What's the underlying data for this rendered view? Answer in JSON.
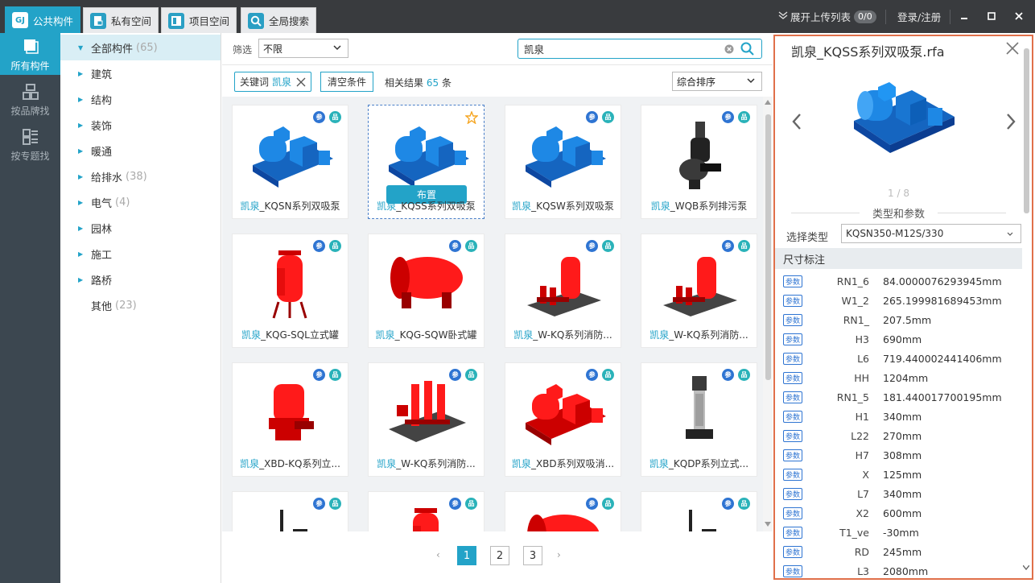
{
  "tabs": [
    {
      "label": "公共构件",
      "icon": "GJ",
      "active": true
    },
    {
      "label": "私有空间",
      "icon": "lock"
    },
    {
      "label": "项目空间",
      "icon": "project"
    },
    {
      "label": "全局搜索",
      "icon": "search"
    }
  ],
  "titlebar": {
    "upload_list": "展开上传列表",
    "upload_count": "0/0",
    "login": "登录/注册",
    "minimize": "_",
    "maximize": "□",
    "close": "✕"
  },
  "leftnav": [
    {
      "label": "所有构件",
      "active": true
    },
    {
      "label": "按品牌找"
    },
    {
      "label": "按专题找"
    }
  ],
  "tree": [
    {
      "label": "全部构件",
      "count": "(65)",
      "selected": true,
      "arrow": "▼"
    },
    {
      "label": "建筑",
      "count": "",
      "arrow": "▶"
    },
    {
      "label": "结构",
      "count": "",
      "arrow": "▶"
    },
    {
      "label": "装饰",
      "count": "",
      "arrow": "▶"
    },
    {
      "label": "暖通",
      "count": "",
      "arrow": "▶"
    },
    {
      "label": "给排水",
      "count": "(38)",
      "arrow": "▶"
    },
    {
      "label": "电气",
      "count": "(4)",
      "arrow": "▶"
    },
    {
      "label": "园林",
      "count": "",
      "arrow": "▶"
    },
    {
      "label": "施工",
      "count": "",
      "arrow": "▶"
    },
    {
      "label": "路桥",
      "count": "",
      "arrow": "▶"
    },
    {
      "label": "其他",
      "count": "(23)",
      "arrow": ""
    }
  ],
  "filter": {
    "label": "筛选",
    "value": "不限",
    "search_value": "凯泉"
  },
  "tags": {
    "keyword_label": "关键词",
    "keyword": "凯泉",
    "clear": "清空条件",
    "result_prefix": "相关结果",
    "result_count": "65",
    "result_suffix": "条",
    "sort": "综合排序"
  },
  "cards": [
    {
      "kw": "凯泉",
      "rest": "_KQSN系列双吸泵",
      "color": "blue",
      "shape": "pump"
    },
    {
      "kw": "凯泉",
      "rest": "_KQSS系列双吸泵",
      "color": "blue",
      "shape": "pump",
      "hover": true,
      "place": "布置"
    },
    {
      "kw": "凯泉",
      "rest": "_KQSW系列双吸泵",
      "color": "blue",
      "shape": "pump"
    },
    {
      "kw": "凯泉",
      "rest": "_WQB系列排污泵",
      "color": "black",
      "shape": "sewage"
    },
    {
      "kw": "凯泉",
      "rest": "_KQG-SQL立式罐",
      "color": "red",
      "shape": "vtank"
    },
    {
      "kw": "凯泉",
      "rest": "_KQG-SQW卧式罐",
      "color": "red",
      "shape": "htank"
    },
    {
      "kw": "凯泉",
      "rest": "_W-KQ系列消防...",
      "color": "red",
      "shape": "station"
    },
    {
      "kw": "凯泉",
      "rest": "_W-KQ系列消防...",
      "color": "red",
      "shape": "station"
    },
    {
      "kw": "凯泉",
      "rest": "_XBD-KQ系列立...",
      "color": "red",
      "shape": "vpump"
    },
    {
      "kw": "凯泉",
      "rest": "_W-KQ系列消防...",
      "color": "red",
      "shape": "multi"
    },
    {
      "kw": "凯泉",
      "rest": "_XBD系列双吸消...",
      "color": "red",
      "shape": "pump"
    },
    {
      "kw": "凯泉",
      "rest": "_KQDP系列立式...",
      "color": "black",
      "shape": "column"
    },
    {
      "kw": "",
      "rest": "",
      "color": "black",
      "shape": "misc"
    },
    {
      "kw": "",
      "rest": "",
      "color": "red",
      "shape": "vtank"
    },
    {
      "kw": "",
      "rest": "",
      "color": "red",
      "shape": "htank"
    },
    {
      "kw": "",
      "rest": "",
      "color": "black",
      "shape": "misc"
    }
  ],
  "pager": {
    "pages": [
      "1",
      "2",
      "3"
    ],
    "current": "1",
    "prev": "‹",
    "next": "›"
  },
  "detail": {
    "title": "凯泉_KQSS系列双吸泵.rfa",
    "counter": "1 / 8",
    "section": "类型和参数",
    "type_label": "选择类型",
    "type_value": "KQSN350-M12S/330",
    "dim_header": "尺寸标注",
    "tag": "参数",
    "params": [
      {
        "name": "RN1_6",
        "value": "84.0000076293945mm"
      },
      {
        "name": "W1_2",
        "value": "265.199981689453mm"
      },
      {
        "name": "RN1_",
        "value": "207.5mm"
      },
      {
        "name": "H3",
        "value": "690mm"
      },
      {
        "name": "L6",
        "value": "719.440002441406mm"
      },
      {
        "name": "HH",
        "value": "1204mm"
      },
      {
        "name": "RN1_5",
        "value": "181.440017700195mm"
      },
      {
        "name": "H1",
        "value": "340mm"
      },
      {
        "name": "L22",
        "value": "270mm"
      },
      {
        "name": "H7",
        "value": "308mm"
      },
      {
        "name": "X",
        "value": "125mm"
      },
      {
        "name": "L7",
        "value": "340mm"
      },
      {
        "name": "X2",
        "value": "600mm"
      },
      {
        "name": "T1_ve",
        "value": "-30mm"
      },
      {
        "name": "RD",
        "value": "245mm"
      },
      {
        "name": "L3",
        "value": "2080mm"
      }
    ]
  },
  "colors": {
    "accent": "#23a3c8",
    "pump_blue": "#1e88e5",
    "tank_red": "#e00000",
    "highlight_border": "#e0704a"
  }
}
